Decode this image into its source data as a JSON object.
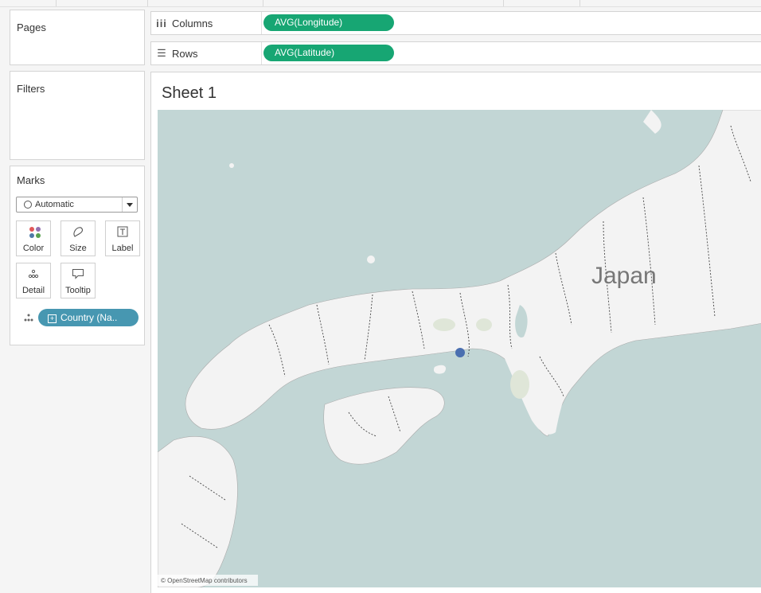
{
  "panels": {
    "pages": {
      "title": "Pages"
    },
    "filters": {
      "title": "Filters"
    },
    "marks": {
      "title": "Marks",
      "mark_type": "Automatic",
      "buttons": [
        {
          "label": "Color"
        },
        {
          "label": "Size"
        },
        {
          "label": "Label"
        },
        {
          "label": "Detail"
        },
        {
          "label": "Tooltip"
        }
      ],
      "field_pill": "Country (Na.."
    }
  },
  "shelves": {
    "columns": {
      "label": "Columns",
      "field": "AVG(Longitude)"
    },
    "rows": {
      "label": "Rows",
      "field": "AVG(Latitude)"
    }
  },
  "sheet": {
    "title": "Sheet 1",
    "map_label": "Japan",
    "attribution": "© OpenStreetMap contributors"
  },
  "colors": {
    "accent_green": "#17a673",
    "pill_blue": "#4797b1",
    "water": "#c2d6d5",
    "land": "#f3f3f3",
    "data_point": "#4a6fb0"
  }
}
